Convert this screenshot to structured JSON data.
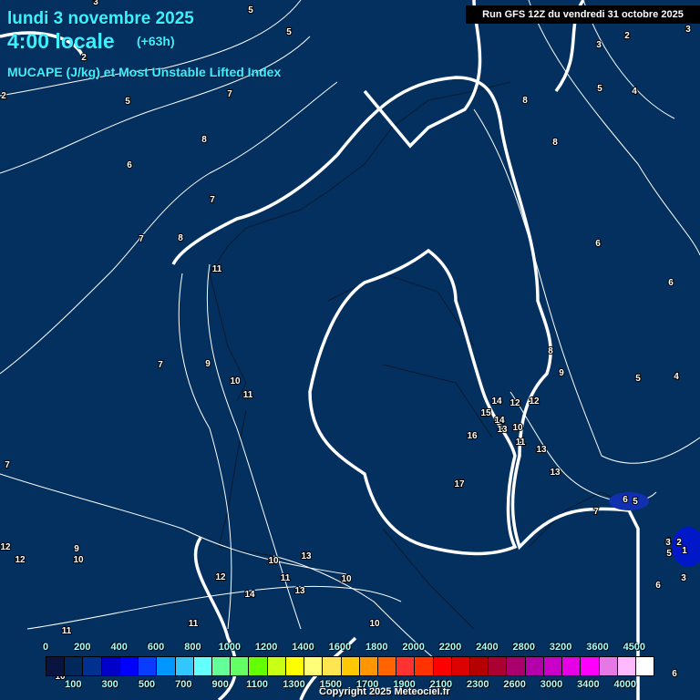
{
  "header": {
    "date": "lundi 3 novembre 2025",
    "time": "4:00 locale",
    "lead": "(+63h)",
    "parameter": "MUCAPE (J/kg) et Most Unstable Lifted Index",
    "run": "Run GFS 12Z du vendredi 31 octobre 2025"
  },
  "colors": {
    "background": "#03305e",
    "contour": "#ffffff",
    "title": "#3cf0ff"
  },
  "legend": {
    "top_labels": [
      "0",
      "200",
      "400",
      "600",
      "800",
      "1000",
      "1200",
      "1400",
      "1600",
      "1800",
      "2000",
      "2200",
      "2400",
      "2800",
      "3200",
      "3600",
      "4500"
    ],
    "bottom_labels": [
      "100",
      "300",
      "500",
      "700",
      "900",
      "1100",
      "1300",
      "1500",
      "1700",
      "1900",
      "2100",
      "2300",
      "2600",
      "3000",
      "3400",
      "4000"
    ],
    "swatches": [
      "#0a1440",
      "#00285a",
      "#003090",
      "#0000c8",
      "#0000ff",
      "#0a3cff",
      "#0096ff",
      "#32c8ff",
      "#64ffff",
      "#64ff96",
      "#64ff64",
      "#64ff00",
      "#c8ff14",
      "#ffff00",
      "#ffff78",
      "#ffe650",
      "#ffc800",
      "#ff9600",
      "#ff6400",
      "#ff3232",
      "#ff3200",
      "#ff0000",
      "#dc0000",
      "#b40000",
      "#aa0032",
      "#aa006e",
      "#b400aa",
      "#c800c8",
      "#e600e6",
      "#ff00ff",
      "#e678e6",
      "#ffb9ff",
      "#ffffff"
    ]
  },
  "contour_labels": [
    "3",
    "2",
    "5",
    "5",
    "3",
    "2",
    "3",
    "5",
    "4",
    "2",
    "5",
    "7",
    "8",
    "8",
    "8",
    "6",
    "7",
    "7",
    "8",
    "11",
    "6",
    "6",
    "7",
    "9",
    "10",
    "11",
    "5",
    "4",
    "14",
    "12",
    "12",
    "8",
    "9",
    "15",
    "14",
    "13",
    "10",
    "11",
    "16",
    "13",
    "13",
    "17",
    "7",
    "6",
    "5",
    "4",
    "7",
    "12",
    "12",
    "9",
    "10",
    "10",
    "10",
    "11",
    "12",
    "13",
    "14",
    "13",
    "11",
    "5",
    "3",
    "2",
    "1",
    "3",
    "6",
    "10",
    "11",
    "10",
    "6"
  ],
  "copyright": "Copyright 2025 Meteociel.fr"
}
